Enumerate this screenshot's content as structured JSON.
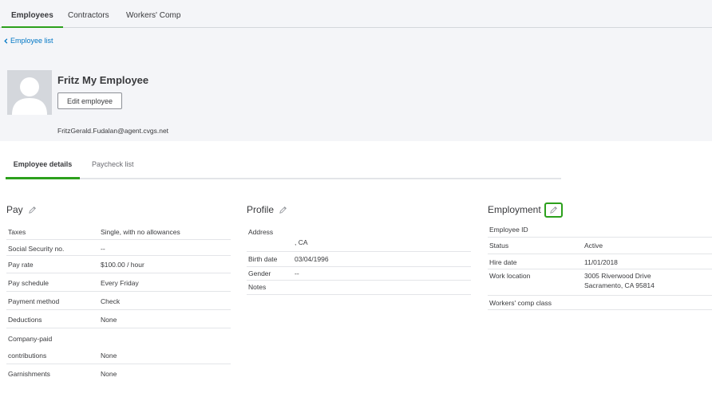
{
  "top_tabs": [
    "Employees",
    "Contractors",
    "Workers' Comp"
  ],
  "back_link": "Employee list",
  "employee": {
    "name": "Fritz My Employee",
    "edit_label": "Edit employee",
    "email": "FritzGerald.Fudalan@agent.cvgs.net"
  },
  "sub_tabs": [
    "Employee details",
    "Paycheck list"
  ],
  "pay": {
    "title": "Pay",
    "rows": [
      {
        "label": "Taxes",
        "value": "Single, with no allowances"
      },
      {
        "label": "Social Security no.",
        "value": "--"
      },
      {
        "label": "Pay rate",
        "value": "$100.00 / hour"
      },
      {
        "label": "Pay schedule",
        "value": "Every Friday"
      },
      {
        "label": "Payment method",
        "value": "Check"
      },
      {
        "label": "Deductions",
        "value": "None"
      },
      {
        "label": "Company-paid",
        "value": ""
      },
      {
        "label": "contributions",
        "value": "None"
      },
      {
        "label": "Garnishments",
        "value": "None"
      }
    ]
  },
  "profile": {
    "title": "Profile",
    "rows": [
      {
        "label": "Address",
        "value": ", CA"
      },
      {
        "label": "Birth date",
        "value": "03/04/1996"
      },
      {
        "label": "Gender",
        "value": "--"
      },
      {
        "label": "Notes",
        "value": ""
      }
    ]
  },
  "employment": {
    "title": "Employment",
    "rows": [
      {
        "label": "Employee ID",
        "value": ""
      },
      {
        "label": "Status",
        "value": "Active"
      },
      {
        "label": "Hire date",
        "value": "11/01/2018"
      },
      {
        "label": "Work location",
        "value": "3005 Riverwood Drive",
        "value2": "Sacramento, CA 95814"
      },
      {
        "label": "Workers' comp class",
        "value": ""
      }
    ]
  },
  "colors": {
    "accent": "#2ca01c",
    "link": "#0077c5"
  },
  "icons": [
    "chevron-left-icon",
    "avatar-placeholder-icon",
    "pencil-icon"
  ]
}
